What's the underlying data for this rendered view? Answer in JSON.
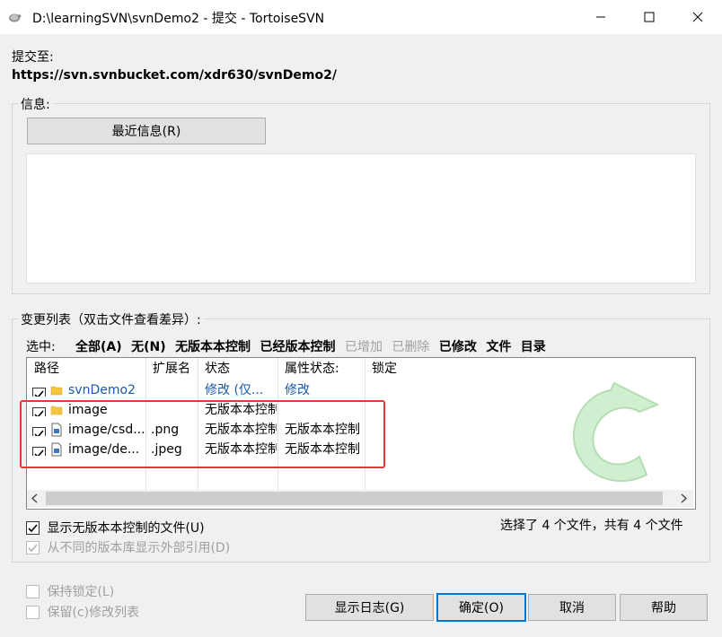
{
  "window": {
    "title": "D:\\learningSVN\\svnDemo2 - 提交 - TortoiseSVN"
  },
  "commit_to": {
    "label": "提交至:",
    "url": "https://svn.svnbucket.com/xdr630/svnDemo2/"
  },
  "message": {
    "group_label": "信息:",
    "recent_button": "最近信息(R)",
    "text": ""
  },
  "changes": {
    "group_label": "变更列表（双击文件查看差异）:",
    "select_label": "选中:",
    "select_links": [
      {
        "label": "全部(A)",
        "enabled": true
      },
      {
        "label": "无(N)",
        "enabled": true
      },
      {
        "label": "无版本本控制",
        "enabled": true
      },
      {
        "label": "已经版本控制",
        "enabled": true
      },
      {
        "label": "已增加",
        "enabled": false
      },
      {
        "label": "已删除",
        "enabled": false
      },
      {
        "label": "已修改",
        "enabled": true
      },
      {
        "label": "文件",
        "enabled": true
      },
      {
        "label": "目录",
        "enabled": true
      }
    ],
    "columns": [
      "路径",
      "扩展名",
      "状态",
      "属性状态:",
      "锁定"
    ],
    "rows": [
      {
        "path": "svnDemo2",
        "ext": "",
        "status": "修改 (仅...",
        "prop_status": "修改",
        "lock": "",
        "checked": true,
        "icon": "folder-icon",
        "highlight": true
      },
      {
        "path": "image",
        "ext": "",
        "status": "无版本本控制",
        "prop_status": "",
        "lock": "",
        "checked": true,
        "icon": "folder-icon",
        "highlight": false
      },
      {
        "path": "image/csd...",
        "ext": ".png",
        "status": "无版本本控制",
        "prop_status": "无版本本控制",
        "lock": "",
        "checked": true,
        "icon": "image-file-icon",
        "highlight": false
      },
      {
        "path": "image/de...",
        "ext": ".jpeg",
        "status": "无版本本控制",
        "prop_status": "无版本本控制",
        "lock": "",
        "checked": true,
        "icon": "image-file-icon",
        "highlight": false
      }
    ],
    "show_unversioned": {
      "label": "显示无版本本控制的文件(U)",
      "checked": true
    },
    "show_externals": {
      "label": "从不同的版本库显示外部引用(D)",
      "checked": true,
      "enabled": false
    },
    "summary": "选择了 4 个文件，共有 4 个文件"
  },
  "options": {
    "keep_locks": {
      "label": "保持锁定(L)",
      "checked": false
    },
    "keep_changelist": {
      "label": "保留(c)修改列表",
      "checked": false
    }
  },
  "buttons": {
    "show_log": "显示日志(G)",
    "ok": "确定(O)",
    "cancel": "取消",
    "help": "帮助"
  },
  "colors": {
    "accent": "#0078d7",
    "highlight_box": "#e53935",
    "link_blue": "#1a5aa8"
  }
}
